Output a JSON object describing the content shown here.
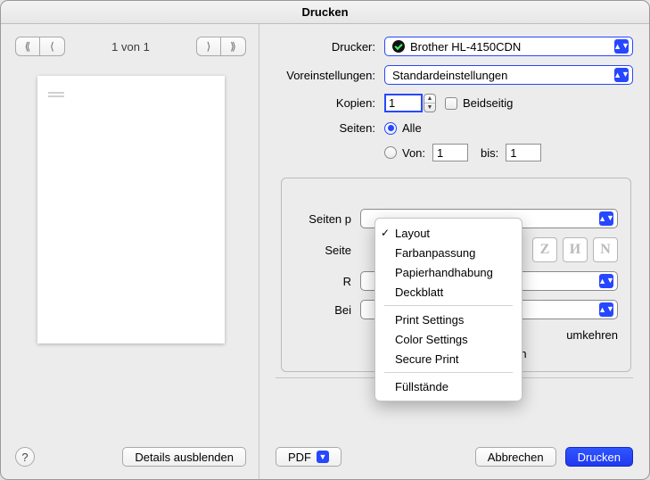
{
  "window": {
    "title": "Drucken"
  },
  "preview": {
    "page_counter": "1 von 1"
  },
  "buttons": {
    "details": "Details ausblenden",
    "pdf": "PDF",
    "cancel": "Abbrechen",
    "print": "Drucken",
    "help": "?"
  },
  "labels": {
    "printer": "Drucker:",
    "presets": "Voreinstellungen:",
    "copies": "Kopien:",
    "two_sided": "Beidseitig",
    "pages": "Seiten:",
    "all": "Alle",
    "from": "Von:",
    "to": "bis:"
  },
  "values": {
    "printer": "Brother HL-4150CDN",
    "presets": "Standardeinstellungen",
    "copies": "1",
    "from": "1",
    "to": "1"
  },
  "group": {
    "pages_per_sheet_label": "Seiten p",
    "layout_dir_label": "Seite",
    "border_label": "R",
    "two_sided_label": "Bei",
    "reverse_orientation_suffix": "umkehren",
    "flip_horizontal": "Horizontal spiegeln",
    "layout_icon_glyph": "N"
  },
  "menu": {
    "items": [
      "Layout",
      "Farbanpassung",
      "Papierhandhabung",
      "Deckblatt",
      "Print Settings",
      "Color Settings",
      "Secure Print",
      "Füllstände"
    ],
    "checked_index": 0
  }
}
